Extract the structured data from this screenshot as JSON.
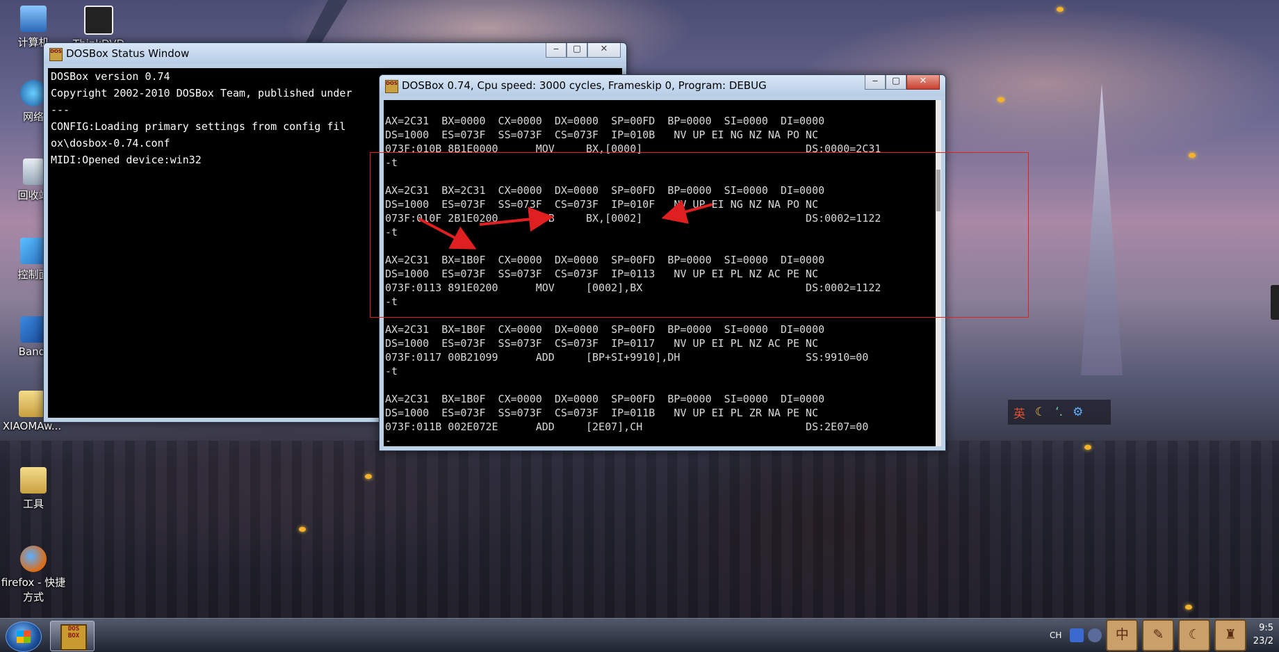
{
  "desktop": {
    "icons": [
      {
        "label": "计算机",
        "icon": "computer-icon"
      },
      {
        "label": "ThinkDVD",
        "icon": "monitor-icon"
      },
      {
        "label": "网络",
        "icon": "network-icon"
      },
      {
        "label": "回收站",
        "icon": "recycle-bin-icon"
      },
      {
        "label": "控制面",
        "icon": "control-panel-icon"
      },
      {
        "label": "Bandi",
        "icon": "bandicam-icon"
      },
      {
        "label": "XIAOMAw...",
        "icon": "folder-icon"
      },
      {
        "label": "工具",
        "icon": "folder-icon"
      },
      {
        "label": "firefox - 快捷方式",
        "icon": "firefox-icon"
      }
    ]
  },
  "status_window": {
    "title": "DOSBox Status Window",
    "lines": [
      "DOSBox version 0.74",
      "Copyright 2002-2010 DOSBox Team, published under",
      "---",
      "CONFIG:Loading primary settings from config fil",
      "ox\\dosbox-0.74.conf",
      "MIDI:Opened device:win32"
    ]
  },
  "dosbox_window": {
    "title": "DOSBox 0.74, Cpu speed:     3000 cycles, Frameskip  0, Program:    DEBUG",
    "lines": [
      "",
      "AX=2C31  BX=0000  CX=0000  DX=0000  SP=00FD  BP=0000  SI=0000  DI=0000",
      "DS=1000  ES=073F  SS=073F  CS=073F  IP=010B   NV UP EI NG NZ NA PO NC",
      "073F:010B 8B1E0000      MOV     BX,[0000]                          DS:0000=2C31",
      "-t",
      "",
      "AX=2C31  BX=2C31  CX=0000  DX=0000  SP=00FD  BP=0000  SI=0000  DI=0000",
      "DS=1000  ES=073F  SS=073F  CS=073F  IP=010F   NV UP EI NG NZ NA PO NC",
      "073F:010F 2B1E0200      SUB     BX,[0002]                          DS:0002=1122",
      "-t",
      "",
      "AX=2C31  BX=1B0F  CX=0000  DX=0000  SP=00FD  BP=0000  SI=0000  DI=0000",
      "DS=1000  ES=073F  SS=073F  CS=073F  IP=0113   NV UP EI PL NZ AC PE NC",
      "073F:0113 891E0200      MOV     [0002],BX                          DS:0002=1122",
      "-t",
      "",
      "AX=2C31  BX=1B0F  CX=0000  DX=0000  SP=00FD  BP=0000  SI=0000  DI=0000",
      "DS=1000  ES=073F  SS=073F  CS=073F  IP=0117   NV UP EI PL NZ AC PE NC",
      "073F:0117 00B21099      ADD     [BP+SI+9910],DH                    SS:9910=00",
      "-t",
      "",
      "AX=2C31  BX=1B0F  CX=0000  DX=0000  SP=00FD  BP=0000  SI=0000  DI=0000",
      "DS=1000  ES=073F  SS=073F  CS=073F  IP=011B   NV UP EI PL ZR NA PE NC",
      "073F:011B 002E072E      ADD     [2E07],CH                          DS:2E07=00",
      "-_"
    ]
  },
  "ime_bar": {
    "mode": "英"
  },
  "taskbar": {
    "dos_icon_text": "DOS BOX",
    "tray_lang": "CH",
    "tray_tiles": [
      "中",
      "",
      "",
      "",
      ""
    ],
    "clock_time": "9:5",
    "clock_date": "23/2"
  },
  "colors": {
    "annotation": "#e02020",
    "console_bg": "#000000"
  }
}
